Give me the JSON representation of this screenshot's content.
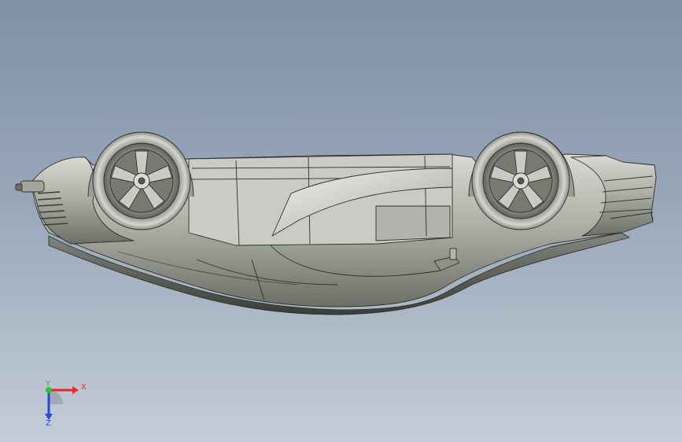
{
  "viewport": {
    "background_top": "#7f91a5",
    "background_bottom": "#c3ccd7"
  },
  "model": {
    "body_color": "#b9bcb2",
    "edge_color": "#2f312d",
    "tire_color": "#c6c8c1",
    "rim_color": "#55584f"
  },
  "triad": {
    "x_label": "X",
    "y_label": "Y",
    "z_label": "Z",
    "x_color": "#e8282b",
    "y_color": "#2fbf3a",
    "z_color": "#2f47d6"
  }
}
